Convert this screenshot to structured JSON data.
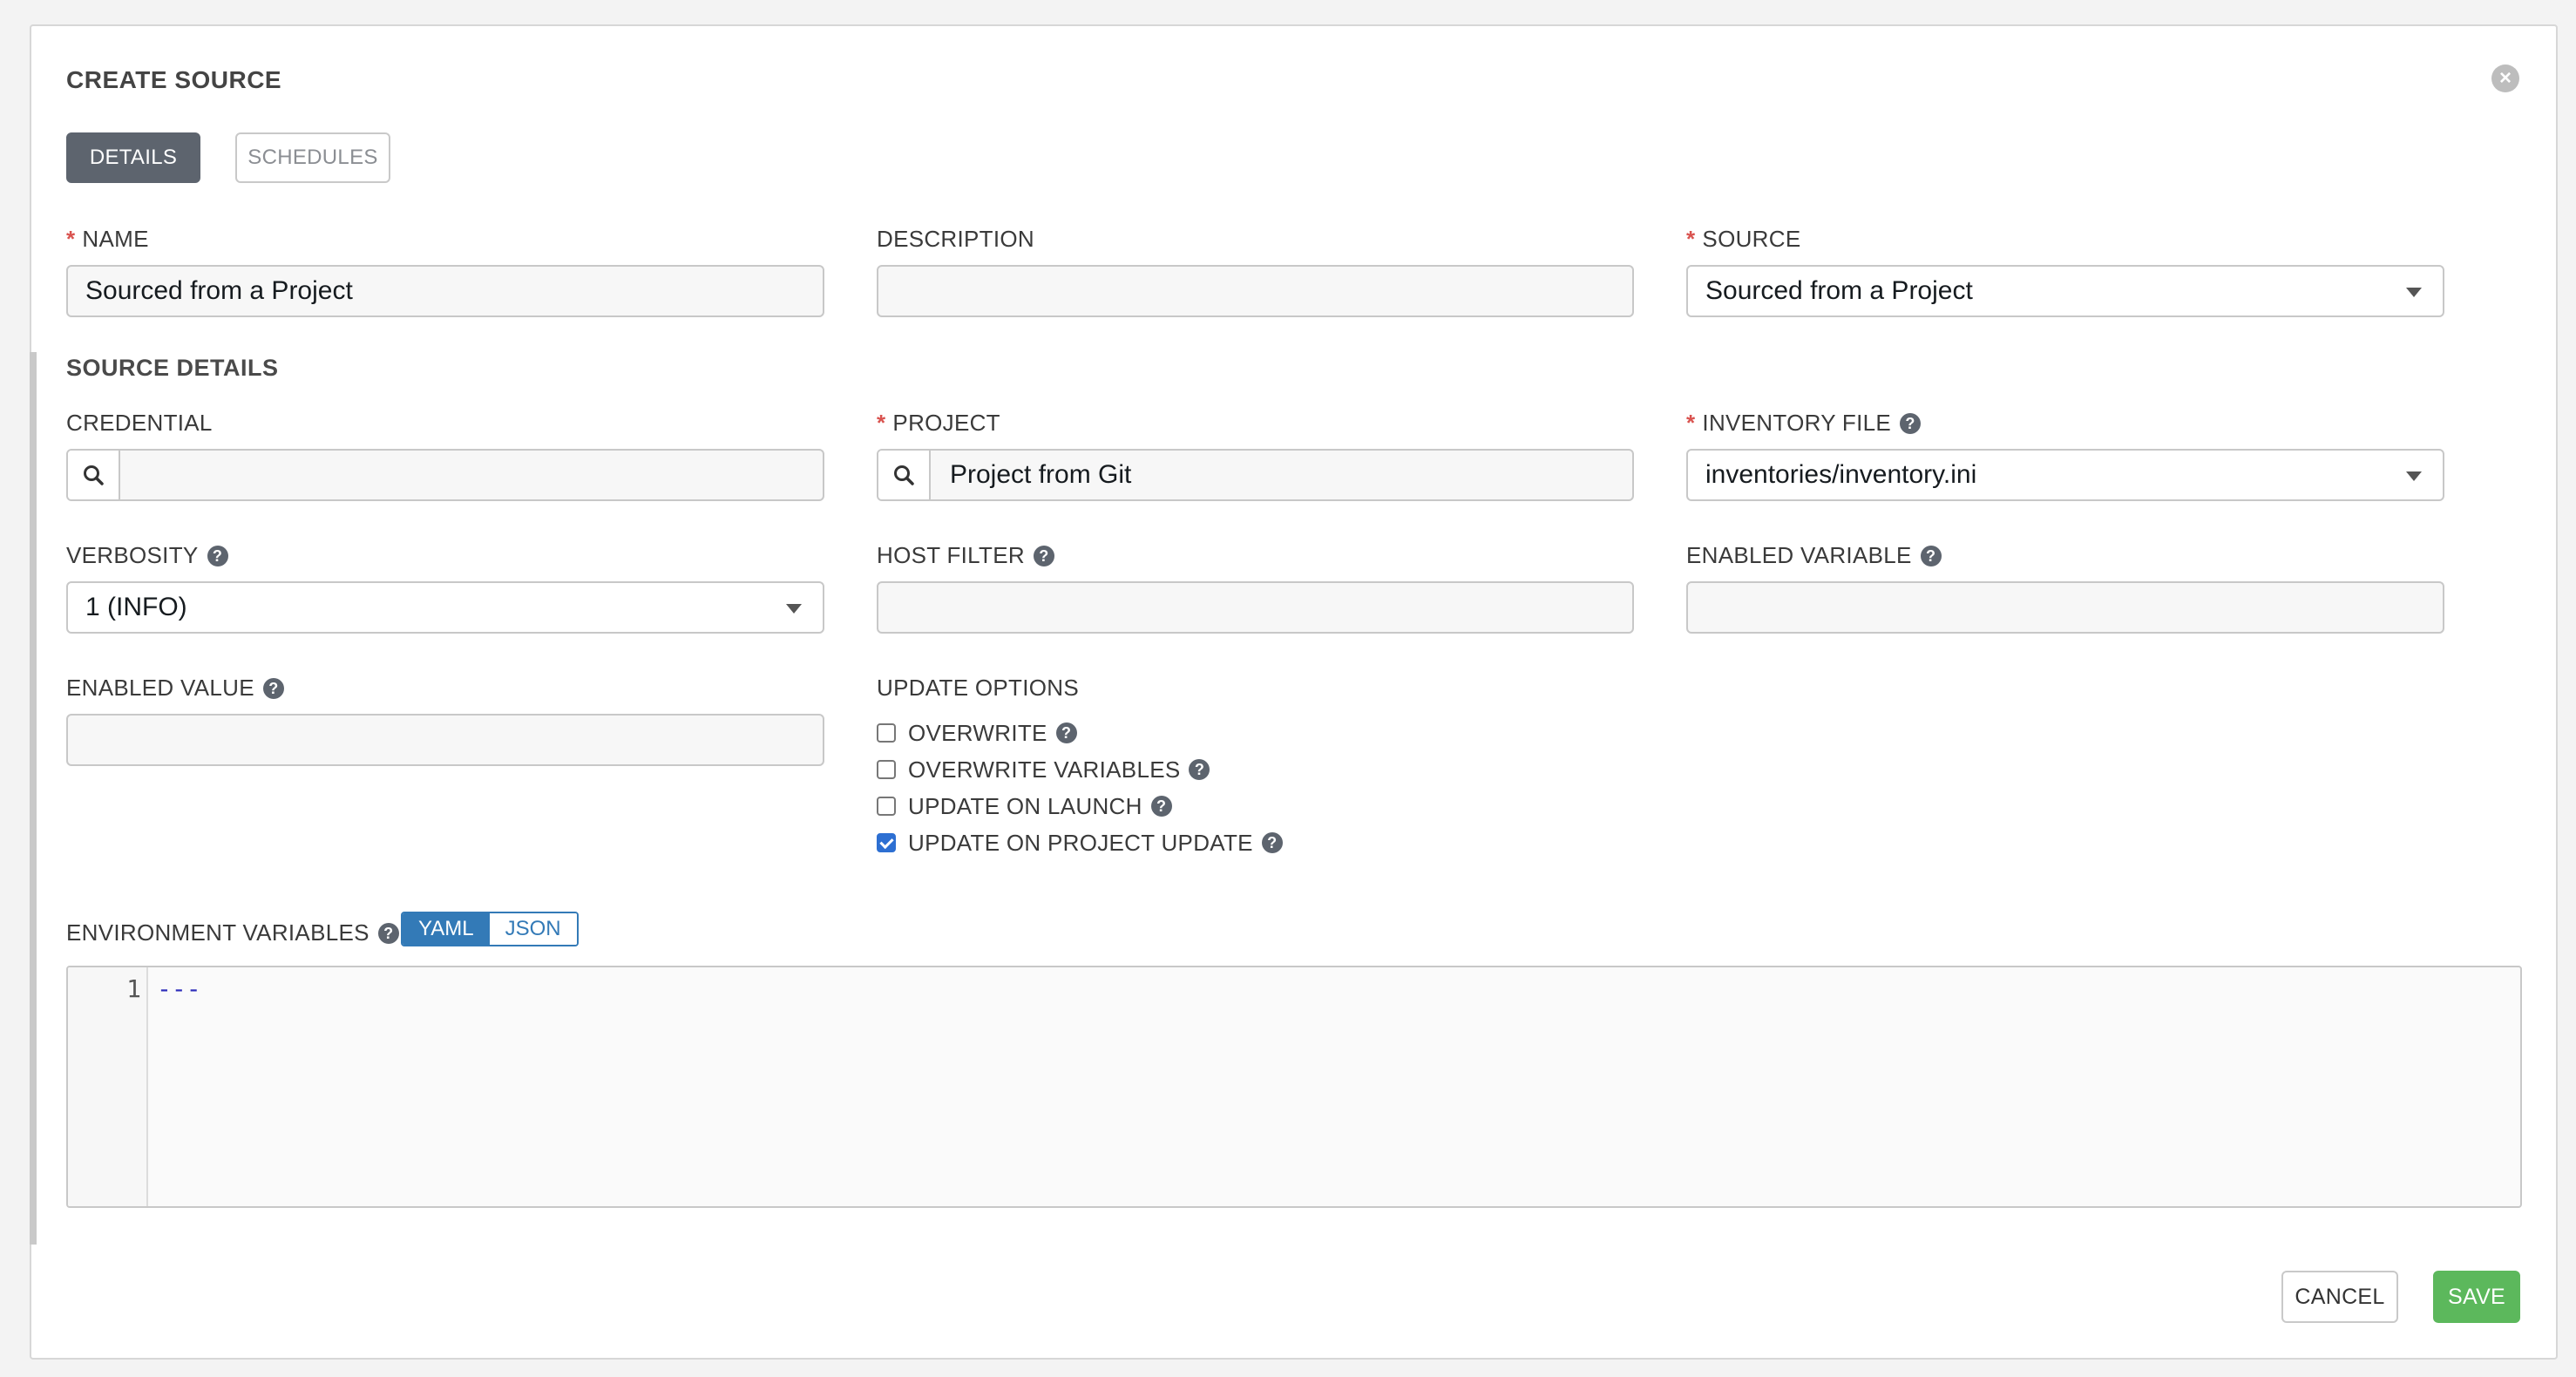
{
  "dialog": {
    "title": "CREATE SOURCE",
    "tabs": [
      {
        "label": "DETAILS",
        "active": true
      },
      {
        "label": "SCHEDULES",
        "active": false
      }
    ]
  },
  "fields": {
    "name": {
      "label": "NAME",
      "required": true,
      "value": "Sourced from a Project"
    },
    "description": {
      "label": "DESCRIPTION",
      "value": ""
    },
    "source": {
      "label": "SOURCE",
      "required": true,
      "value": "Sourced from a Project"
    }
  },
  "source_details": {
    "title": "SOURCE DETAILS",
    "credential": {
      "label": "CREDENTIAL",
      "value": ""
    },
    "project": {
      "label": "PROJECT",
      "required": true,
      "value": "Project from Git"
    },
    "inventory_file": {
      "label": "INVENTORY FILE",
      "required": true,
      "value": "inventories/inventory.ini"
    },
    "verbosity": {
      "label": "VERBOSITY",
      "value": "1 (INFO)"
    },
    "host_filter": {
      "label": "HOST FILTER",
      "value": ""
    },
    "enabled_variable": {
      "label": "ENABLED VARIABLE",
      "value": ""
    },
    "enabled_value": {
      "label": "ENABLED VALUE",
      "value": ""
    },
    "update_options": {
      "label": "UPDATE OPTIONS",
      "items": [
        {
          "label": "OVERWRITE",
          "checked": false
        },
        {
          "label": "OVERWRITE VARIABLES",
          "checked": false
        },
        {
          "label": "UPDATE ON LAUNCH",
          "checked": false
        },
        {
          "label": "UPDATE ON PROJECT UPDATE",
          "checked": true
        }
      ]
    },
    "environment_variables": {
      "label": "ENVIRONMENT VARIABLES",
      "modes": [
        "YAML",
        "JSON"
      ],
      "active_mode": "YAML",
      "line_number": "1",
      "content": "---"
    }
  },
  "actions": {
    "cancel_label": "CANCEL",
    "save_label": "SAVE"
  },
  "icons": {
    "help": "help-icon",
    "search": "search-icon",
    "close": "close-icon",
    "dropdown": "chevron-down-icon"
  },
  "colors": {
    "active_tab": "#5d646e",
    "required_marker": "#d9534f",
    "save_button": "#5cb85c",
    "toggle_accent": "#337ab7",
    "checkbox_checked": "#2d6fd2"
  }
}
